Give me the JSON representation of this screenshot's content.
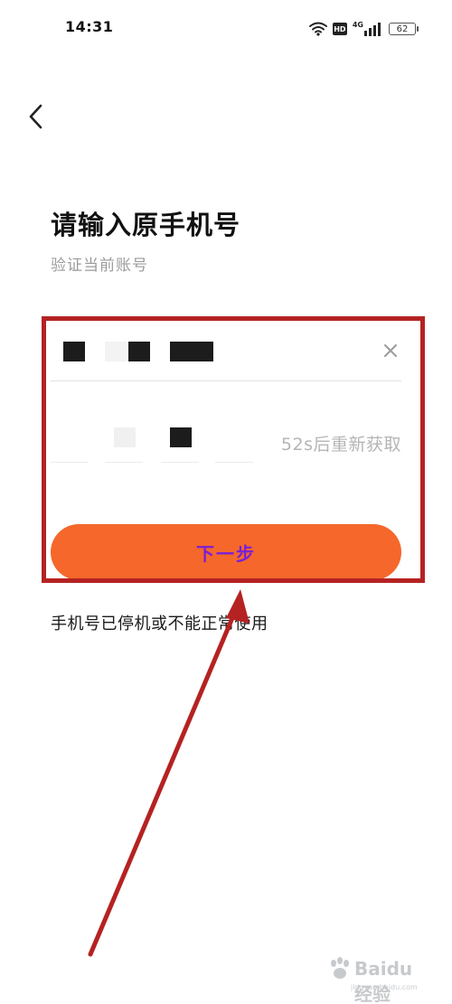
{
  "status_bar": {
    "time": "14:31",
    "hd_badge": "HD",
    "network_label": "4G",
    "battery_level": "62",
    "icons": [
      "wifi-icon",
      "hd-icon",
      "signal-icon",
      "battery-icon"
    ]
  },
  "header": {
    "back_icon": "chevron-left-icon"
  },
  "main": {
    "title": "请输入原手机号",
    "subtitle": "验证当前账号",
    "phone_field": {
      "clear_icon": "close-icon"
    },
    "verification": {
      "resend_label": "52s后重新获取"
    },
    "next_button_label": "下一步",
    "help_link": "手机号已停机或不能正常使用"
  },
  "colors": {
    "accent": "#f5672b",
    "button_text": "#7a1fd6",
    "annotation": "#b52222",
    "muted_text": "#9b9b9b"
  },
  "watermark": {
    "brand": "Baidu 经验",
    "site": "jingyan.baidu.com"
  }
}
